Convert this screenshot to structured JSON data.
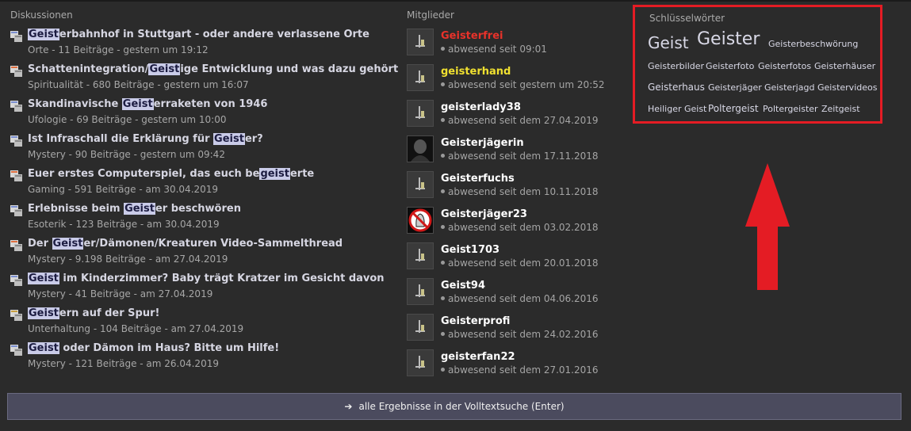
{
  "discussions": {
    "heading": "Diskussionen",
    "items": [
      {
        "pre": "",
        "hl": "Geist",
        "post": "erbahnhof in Stuttgart - oder andere verlassene Orte",
        "meta": "Orte - 11 Beiträge - gestern um 19:12",
        "icon_color": "#7b8fd0"
      },
      {
        "pre": "Schattenintegration/",
        "hl": "Geist",
        "post": "ige Entwicklung und was dazu gehört",
        "meta": "Spiritualität - 680 Beiträge - gestern um 16:07",
        "icon_color": "#e07040"
      },
      {
        "pre": "Skandinavische ",
        "hl": "Geist",
        "post": "erraketen von 1946",
        "meta": "Ufologie - 69 Beiträge - gestern um 10:00",
        "icon_color": "#7b8fd0"
      },
      {
        "pre": "Ist Infraschall die Erklärung für ",
        "hl": "Geist",
        "post": "er?",
        "meta": "Mystery - 90 Beiträge - gestern um 09:42",
        "icon_color": "#7b8fd0"
      },
      {
        "pre": "Euer erstes Computerspiel, das euch be",
        "hl": "geist",
        "post": "erte",
        "meta": "Gaming - 591 Beiträge - am 30.04.2019",
        "icon_color": "#e07040"
      },
      {
        "pre": "Erlebnisse beim ",
        "hl": "Geist",
        "post": "er beschwören",
        "meta": "Esoterik - 123 Beiträge - am 30.04.2019",
        "icon_color": "#7b8fd0"
      },
      {
        "pre": "Der ",
        "hl": "Geist",
        "post": "er/Dämonen/Kreaturen Video-Sammelthread",
        "meta": "Mystery - 9.198 Beiträge - am 27.04.2019",
        "icon_color": "#e07040"
      },
      {
        "pre": "",
        "hl": "Geist",
        "post": " im Kinderzimmer? Baby trägt Kratzer im Gesicht davon",
        "meta": "Mystery - 41 Beiträge - am 27.04.2019",
        "icon_color": "#7b8fd0"
      },
      {
        "pre": "",
        "hl": "Geist",
        "post": "ern auf der Spur!",
        "meta": "Unterhaltung - 104 Beiträge - am 27.04.2019",
        "icon_color": "#c8a040"
      },
      {
        "pre": "",
        "hl": "Geist",
        "post": " oder Dämon im Haus? Bitte um Hilfe!",
        "meta": "Mystery - 121 Beiträge - am 26.04.2019",
        "icon_color": "#7b8fd0"
      }
    ]
  },
  "members": {
    "heading": "Mitglieder",
    "items": [
      {
        "name": "Geisterfrei",
        "status": "abwesend seit 09:01",
        "color": "#e8322a",
        "avatar": "default"
      },
      {
        "name": "geisterhand",
        "status": "abwesend seit gestern um 20:52",
        "color": "#f0e030",
        "avatar": "default"
      },
      {
        "name": "geisterlady38",
        "status": "abwesend seit dem 27.04.2019",
        "color": "#ffffff",
        "avatar": "default"
      },
      {
        "name": "Geisterjägerin",
        "status": "abwesend seit dem 17.11.2018",
        "color": "#ffffff",
        "avatar": "photo"
      },
      {
        "name": "Geisterfuchs",
        "status": "abwesend seit dem 10.11.2018",
        "color": "#ffffff",
        "avatar": "default"
      },
      {
        "name": "Geisterjäger23",
        "status": "abwesend seit dem 03.02.2018",
        "color": "#ffffff",
        "avatar": "ghostbusters"
      },
      {
        "name": "Geist1703",
        "status": "abwesend seit dem 20.01.2018",
        "color": "#ffffff",
        "avatar": "default"
      },
      {
        "name": "Geist94",
        "status": "abwesend seit dem 04.06.2016",
        "color": "#ffffff",
        "avatar": "default"
      },
      {
        "name": "Geisterprofi",
        "status": "abwesend seit dem 24.02.2016",
        "color": "#ffffff",
        "avatar": "default"
      },
      {
        "name": "geisterfan22",
        "status": "abwesend seit dem 27.01.2016",
        "color": "#ffffff",
        "avatar": "default"
      }
    ]
  },
  "keywords": {
    "heading": "Schlüsselwörter",
    "items": [
      {
        "text": "Geist",
        "size": 20
      },
      {
        "text": "Geister",
        "size": 22
      },
      {
        "text": "Geisterbeschwörung",
        "size": 11
      },
      {
        "text": "Geisterbilder",
        "size": 11
      },
      {
        "text": "Geisterfoto",
        "size": 11
      },
      {
        "text": "Geisterfotos",
        "size": 11
      },
      {
        "text": "Geisterhäuser",
        "size": 11
      },
      {
        "text": "Geisterhaus",
        "size": 12
      },
      {
        "text": "Geisterjäger",
        "size": 11
      },
      {
        "text": "Geisterjagd",
        "size": 11
      },
      {
        "text": "Geistervideos",
        "size": 11
      },
      {
        "text": "Heiliger Geist",
        "size": 11
      },
      {
        "text": "Poltergeist",
        "size": 12
      },
      {
        "text": "Poltergeister",
        "size": 11
      },
      {
        "text": "Zeitgeist",
        "size": 11
      }
    ]
  },
  "search": {
    "label": "alle Ergebnisse in der Volltextsuche (Enter)",
    "arrow": "➔"
  },
  "colors": {
    "highlight_box": "#e41c24",
    "arrow": "#e41c24"
  }
}
